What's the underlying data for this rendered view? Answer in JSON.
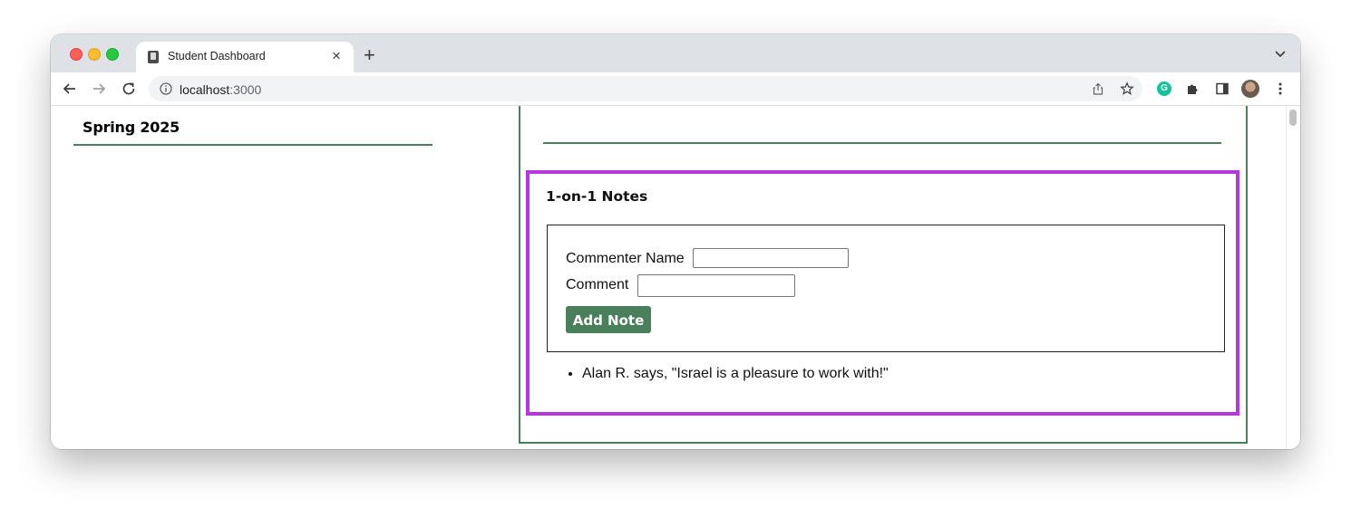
{
  "browser": {
    "tab_title": "Student Dashboard",
    "url_host": "localhost",
    "url_port": ":3000"
  },
  "dashboard": {
    "semester_title": "Spring 2025"
  },
  "notes": {
    "heading": "1-on-1 Notes",
    "commenter_label": "Commenter Name",
    "commenter_value": "",
    "comment_label": "Comment",
    "comment_value": "",
    "add_button_label": "Add Note",
    "items": [
      "Alan R. says, \"Israel is a pleasure to work with!\""
    ]
  },
  "colors": {
    "accent_green": "#4a7f5c",
    "highlight_purple": "#b637e0"
  }
}
